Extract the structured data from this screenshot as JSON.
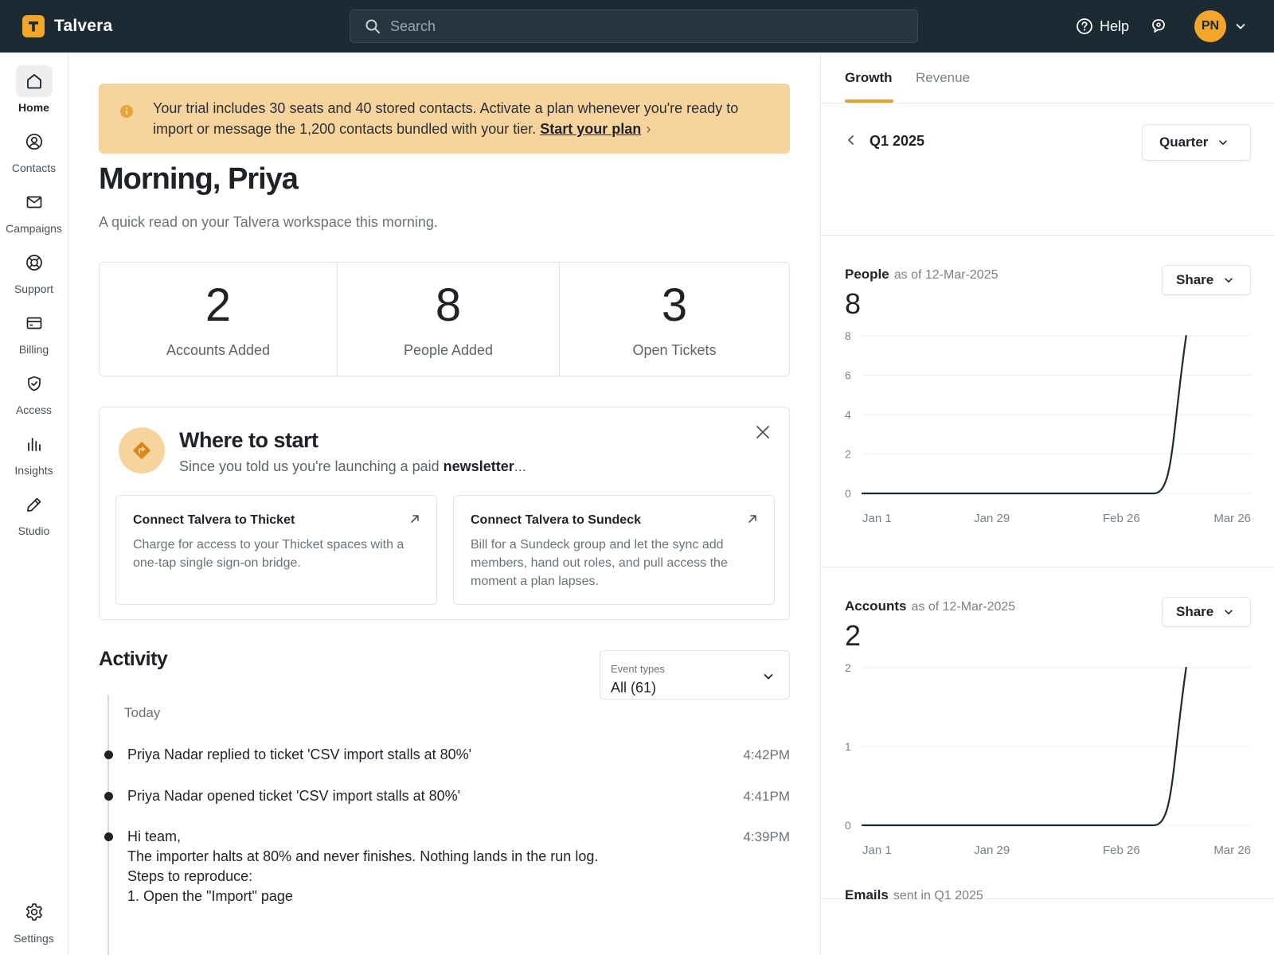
{
  "app": {
    "name": "Talvera",
    "logo_letter": "T",
    "brand_color": "#f4a62a"
  },
  "search": {
    "placeholder": "Search"
  },
  "topbar": {
    "help_label": "Help",
    "user_initials": "PN"
  },
  "sidebar": {
    "items": [
      {
        "label": "Home",
        "icon": "home-icon",
        "active": true
      },
      {
        "label": "Contacts",
        "icon": "user-circle-icon"
      },
      {
        "label": "Campaigns",
        "icon": "mail-icon"
      },
      {
        "label": "Support",
        "icon": "lifebuoy-icon"
      },
      {
        "label": "Billing",
        "icon": "credit-card-icon"
      },
      {
        "label": "Access",
        "icon": "shield-check-icon"
      },
      {
        "label": "Insights",
        "icon": "bar-chart-icon"
      },
      {
        "label": "Studio",
        "icon": "pencil-icon"
      }
    ],
    "settings_label": "Settings"
  },
  "banner": {
    "text": "Your trial includes 30 seats and 40 stored contacts. Activate a plan whenever you're ready to import or message the 1,200 contacts bundled with your tier.",
    "link_label": "Start your plan",
    "link_arrow": "›"
  },
  "greeting": {
    "title": "Morning, Priya",
    "subtitle": "A quick read on your Talvera workspace this morning."
  },
  "stats": [
    {
      "value": "2",
      "label": "Accounts Added"
    },
    {
      "value": "8",
      "label": "People Added"
    },
    {
      "value": "3",
      "label": "Open Tickets"
    }
  ],
  "where_to_start": {
    "title": "Where to start",
    "subtitle_prefix": "Since you told us you're launching a paid",
    "subtitle_bold": "newsletter",
    "subtitle_suffix": "...",
    "cards": [
      {
        "title": "Connect Talvera to Thicket",
        "description": "Charge for access to your Thicket spaces with a one-tap single sign-on bridge."
      },
      {
        "title": "Connect Talvera to Sundeck",
        "description": "Bill for a Sundeck group and let the sync add members, hand out roles, and pull access the moment a plan lapses."
      }
    ]
  },
  "activity": {
    "title": "Activity",
    "filter_label": "Event types",
    "filter_value": "All (61)",
    "day_label": "Today",
    "events": [
      {
        "text": "Priya Nadar replied to ticket 'CSV import stalls at 80%'",
        "time": "4:42PM"
      },
      {
        "text": "Priya Nadar opened ticket 'CSV import stalls at 80%'",
        "time": "4:41PM"
      },
      {
        "lines": [
          "Hi team,",
          "The importer halts at 80% and never finishes. Nothing lands in the run log.",
          "Steps to reproduce:",
          "1. Open the \"Import\" page"
        ],
        "time": "4:39PM"
      }
    ]
  },
  "right_panel": {
    "tabs": [
      {
        "label": "Growth",
        "active": true
      },
      {
        "label": "Revenue"
      }
    ],
    "period": "Q1 2025",
    "period_select": "Quarter",
    "share_label": "Share",
    "metrics": [
      {
        "title": "People",
        "as_of": "as of 12-Mar-2025",
        "value": "8"
      },
      {
        "title": "Accounts",
        "as_of": "as of 12-Mar-2025",
        "value": "2"
      }
    ],
    "emails": {
      "title": "Emails",
      "subtitle": "sent in Q1 2025"
    }
  },
  "chart_data": [
    {
      "type": "line",
      "title": "People",
      "x_tick_labels": [
        "Jan 1",
        "Jan 29",
        "Feb 26",
        "Mar 26"
      ],
      "y_ticks": [
        0,
        2,
        4,
        6,
        8
      ],
      "ylim": [
        0,
        8
      ],
      "grid": true,
      "series": [
        {
          "x": [
            "Jan 1",
            "Mar 5",
            "Mar 12"
          ],
          "values": [
            0,
            0,
            8
          ]
        }
      ]
    },
    {
      "type": "line",
      "title": "Accounts",
      "x_tick_labels": [
        "Jan 1",
        "Jan 29",
        "Feb 26",
        "Mar 26"
      ],
      "y_ticks": [
        0,
        1,
        2
      ],
      "ylim": [
        0,
        2
      ],
      "grid": true,
      "series": [
        {
          "x": [
            "Jan 1",
            "Mar 5",
            "Mar 12"
          ],
          "values": [
            0,
            0,
            2
          ]
        }
      ]
    }
  ]
}
